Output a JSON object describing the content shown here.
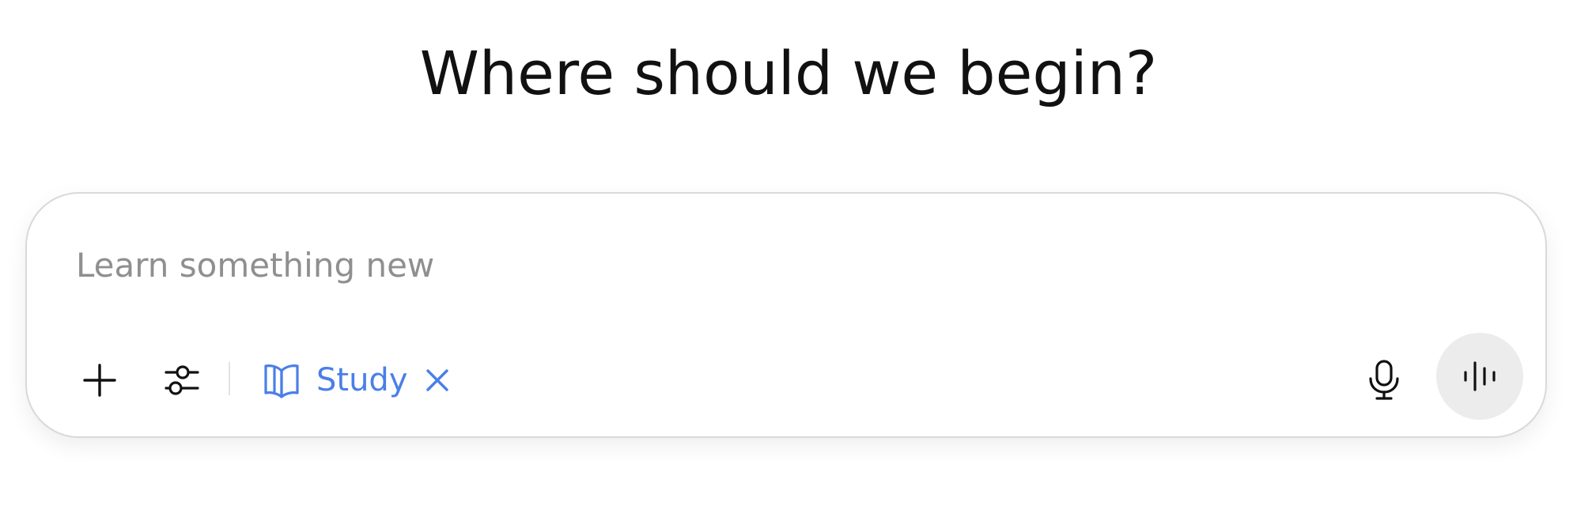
{
  "heading": "Where should we begin?",
  "composer": {
    "placeholder": "Learn something new",
    "value": ""
  },
  "toolbar": {
    "add_icon": "plus-icon",
    "tools_icon": "sliders-icon",
    "mode_chip": {
      "icon": "open-book-icon",
      "label": "Study",
      "remove_icon": "close-icon",
      "color": "#4a7fe8"
    },
    "mic_icon": "microphone-icon",
    "voice_icon": "voice-waveform-icon"
  },
  "colors": {
    "heading": "#111111",
    "placeholder": "#8f8f8f",
    "voice_button_bg": "#ececec",
    "border": "#d9d9d9"
  }
}
